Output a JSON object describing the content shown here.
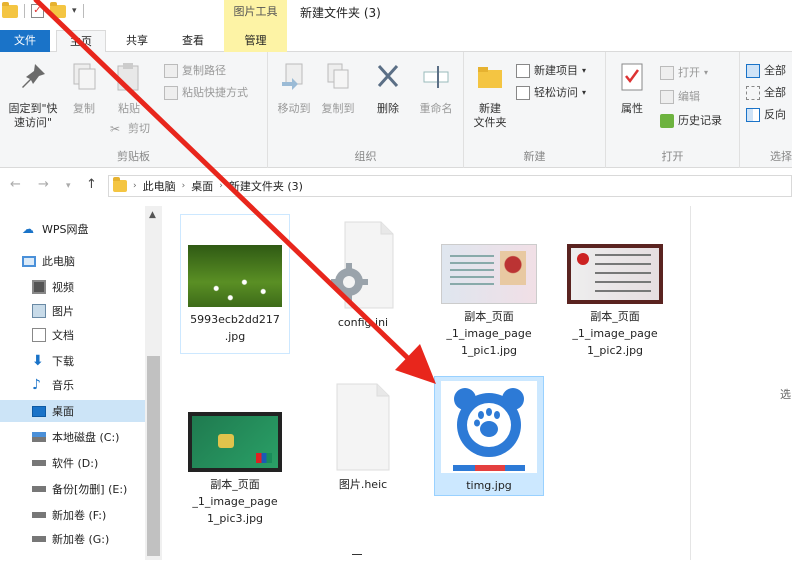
{
  "window": {
    "contextual_tab": "图片工具",
    "title": "新建文件夹 (3)"
  },
  "tabs": {
    "file": "文件",
    "home": "主页",
    "share": "共享",
    "view": "查看",
    "manage": "管理"
  },
  "ribbon": {
    "clipboard": {
      "label": "剪贴板",
      "pin": "固定到\"快\n速访问\"",
      "copy": "复制",
      "paste": "粘贴",
      "copy_path": "复制路径",
      "paste_shortcut": "粘贴快捷方式",
      "cut": "剪切"
    },
    "organize": {
      "label": "组织",
      "move_to": "移动到",
      "copy_to": "复制到",
      "delete": "删除",
      "rename": "重命名"
    },
    "new": {
      "label": "新建",
      "new_folder": "新建\n文件夹",
      "new_item": "新建项目",
      "easy_access": "轻松访问"
    },
    "open": {
      "label": "打开",
      "properties": "属性",
      "open_btn": "打开",
      "edit": "编辑",
      "history": "历史记录"
    },
    "select": {
      "label": "选择",
      "select_all": "全部",
      "select_none": "全部",
      "invert": "反向"
    }
  },
  "address": {
    "crumbs": [
      "此电脑",
      "桌面",
      "新建文件夹 (3)"
    ]
  },
  "nav": {
    "items": [
      {
        "label": "WPS网盘",
        "icon": "cloud-icon"
      },
      {
        "label": "此电脑",
        "icon": "computer-icon"
      },
      {
        "label": "视频",
        "icon": "video-icon"
      },
      {
        "label": "图片",
        "icon": "picture-icon"
      },
      {
        "label": "文档",
        "icon": "document-icon"
      },
      {
        "label": "下载",
        "icon": "download-icon"
      },
      {
        "label": "音乐",
        "icon": "music-icon"
      },
      {
        "label": "桌面",
        "icon": "desktop-icon"
      },
      {
        "label": "本地磁盘 (C:)",
        "icon": "drive-windows-icon"
      },
      {
        "label": "软件 (D:)",
        "icon": "drive-icon"
      },
      {
        "label": "备份[勿删] (E:)",
        "icon": "drive-icon"
      },
      {
        "label": "新加卷 (F:)",
        "icon": "drive-icon"
      },
      {
        "label": "新加卷 (G:)",
        "icon": "drive-icon"
      }
    ]
  },
  "files": [
    {
      "name": "5993ecb2dd217\n.jpg"
    },
    {
      "name": "config.ini"
    },
    {
      "name": "副本_页面\n_1_image_page\n1_pic1.jpg"
    },
    {
      "name": "副本_页面\n_1_image_page\n1_pic2.jpg"
    },
    {
      "name": "副本_页面\n_1_image_page\n1_pic3.jpg"
    },
    {
      "name": "图片.heic"
    },
    {
      "name": "timg.jpg"
    }
  ],
  "preview_hint": "选",
  "colors": {
    "accent": "#1a73c8",
    "arrow": "#e8261c",
    "selection": "#cce8ff",
    "contextual": "#fdf3a5"
  }
}
